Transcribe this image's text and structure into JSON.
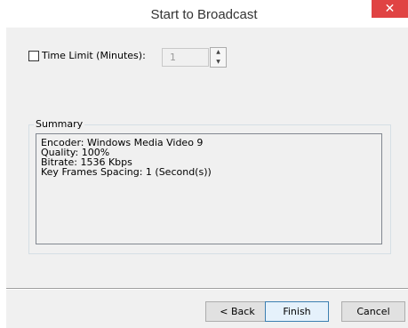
{
  "window": {
    "title": "Start to Broadcast",
    "close_glyph": "✕"
  },
  "time_limit": {
    "checkbox_label": "Time Limit (Minutes):",
    "checked": false,
    "value": "1",
    "spin_up_glyph": "▲",
    "spin_down_glyph": "▼"
  },
  "summary": {
    "group_title": "Summary",
    "lines": [
      "Encoder: Windows Media Video 9",
      "Quality: 100%",
      "Bitrate: 1536 Kbps",
      "Key Frames Spacing: 1 (Second(s))"
    ]
  },
  "buttons": {
    "back_label": "< Back",
    "finish_label": "Finish",
    "cancel_label": "Cancel"
  },
  "colors": {
    "close_button": "#e04343",
    "dialog_background": "#f0f0f0",
    "default_button_border": "#3c7fb1"
  }
}
